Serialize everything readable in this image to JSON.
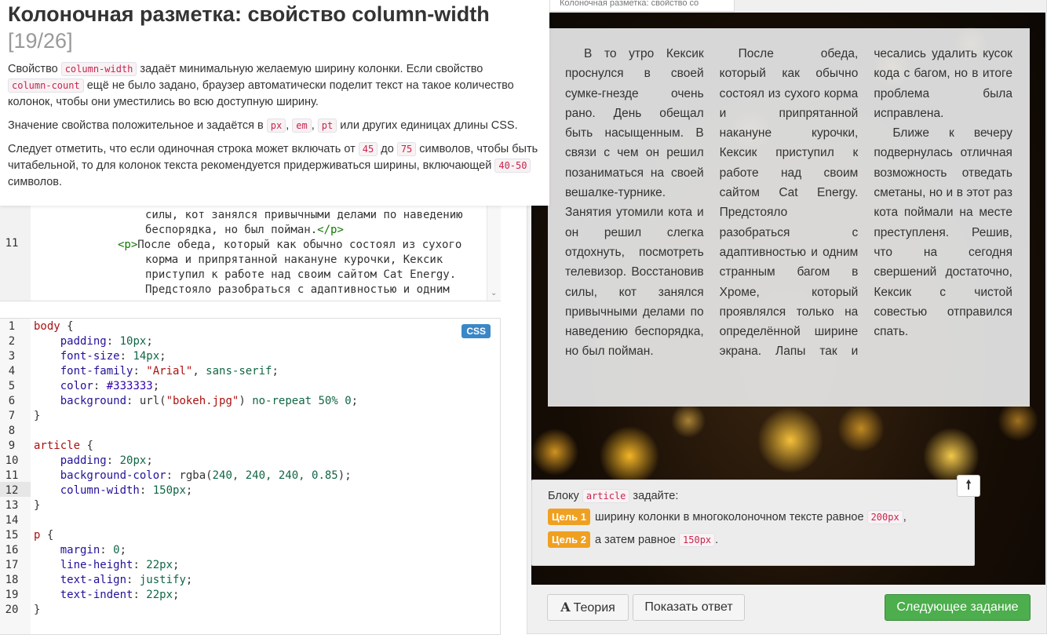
{
  "theory": {
    "title": "Колоночная разметка: свойство column-width",
    "counter": "[19/26]",
    "p1": {
      "t1": "Свойство ",
      "c1": "column-width",
      "t2": " задаёт минимальную желаемую ширину колонки. Если свойство ",
      "c2": "column-count",
      "t3": " ещё не было задано, браузер автоматически поделит текст на такое количество колонок, чтобы они уместились во всю доступную ширину."
    },
    "p2": {
      "t1": "Значение свойства положительное и задаётся в ",
      "c1": "px",
      "s1": ", ",
      "c2": "em",
      "s2": ", ",
      "c3": "pt",
      "t2": " или других единицах длины CSS."
    },
    "p3": {
      "t1": "Следует отметить, что если одиночная строка может включать от ",
      "c1": "45",
      "t2": " до ",
      "c2": "75",
      "t3": " символов, чтобы быть читабельной, то для колонок текста рекомендуется придерживаться ширины, включающей ",
      "c3": "40-50",
      "t4": " символов."
    }
  },
  "html_editor": {
    "line_number": "11",
    "line_a": "силы, кот занялся привычными делами по наведению",
    "line_b_text": "беспорядка, но был пойман.",
    "line_b_tag": "</p>",
    "line_c_tag": "<p>",
    "line_c_text": "После обеда, который как обычно состоял из сухого",
    "line_d": "корма и припрятанной накануне курочки, Кексик",
    "line_e": "приступил к работе над своим сайтом Cat Energy.",
    "line_f": "Предстояло разобраться с адаптивностью и одним"
  },
  "css_editor": {
    "badge": "CSS",
    "line_numbers": [
      "1",
      "2",
      "3",
      "4",
      "5",
      "6",
      "7",
      "8",
      "9",
      "10",
      "11",
      "12",
      "13",
      "14",
      "15",
      "16",
      "17",
      "18",
      "19",
      "20"
    ],
    "l1_sel": "body",
    "l1_brace": " {",
    "l2_prop": "padding",
    "l2_val": "10px",
    "l3_prop": "font-size",
    "l3_val": "14px",
    "l4_prop": "font-family",
    "l4_str": "\"Arial\"",
    "l4_kw": "sans-serif",
    "l5_prop": "color",
    "l5_val": "#333333",
    "l6_prop": "background",
    "l6_fn": "url(",
    "l6_str": "\"bokeh.jpg\"",
    "l6_fn_end": ")",
    "l6_kw": "no-repeat",
    "l6_num1": "50%",
    "l6_num2": "0",
    "l7": "}",
    "l9_sel": "article",
    "l9_brace": " {",
    "l10_prop": "padding",
    "l10_val": "20px",
    "l11_prop": "background-color",
    "l11_fn": "rgba(",
    "l11_nums": "240, 240, 240, 0.85",
    "l11_end": ")",
    "l12_prop": "column-width",
    "l12_val": "150px",
    "l13": "}",
    "l15_sel": "p",
    "l15_brace": " {",
    "l16_prop": "margin",
    "l16_val": "0",
    "l17_prop": "line-height",
    "l17_val": "22px",
    "l18_prop": "text-align",
    "l18_kw": "justify",
    "l19_prop": "text-indent",
    "l19_val": "22px",
    "l20": "}"
  },
  "preview": {
    "tab_title": "Колоночная разметка: свойство co",
    "article_p1": "В то утро Кексик проснулся в своей сумке-гнезде очень рано. День обещал быть насыщенным. В связи с чем он решил позаниматься на своей вешалке-турнике. Занятия утомили кота и он решил слегка отдохнуть, посмотреть телевизор. Восстановив силы, кот занялся привычными делами по наведению беспорядка, но был пойман.",
    "article_p2": "После обеда, который как обычно состоял из сухого корма и припрятанной накануне курочки, Кексик приступил к работе над своим сайтом Cat Energy. Предстояло разобраться с адаптивностью и одним странным багом в Хроме, который проявлялся только на определённой ширине экрана. Лапы так и чесались удалить кусок кода с багом, но в итоге проблема была исправлена.",
    "article_p3": "Ближе к вечеру подвернулась отличная возможность отведать сметаны, но и в этот раз кота поймали на месте преступленя. Решив, что на сегодня свершений достаточно, Кексик с чистой совестью отправился спать."
  },
  "task": {
    "intro_t1": "Блоку ",
    "intro_code": "article",
    "intro_t2": " задайте:",
    "goal1_badge": "Цель 1",
    "goal1_text": "ширину колонки в многоколоночном тексте равное ",
    "goal1_code": "200px",
    "goal1_end": ",",
    "goal2_badge": "Цель 2",
    "goal2_text": "а затем равное ",
    "goal2_code": "150px",
    "goal2_end": ".",
    "up_icon": "arrow-up-icon"
  },
  "buttons": {
    "theory_icon": "A",
    "theory": "Теория",
    "answer": "Показать ответ",
    "next": "Следующее задание"
  },
  "colors": {
    "accent_green": "#4cae4c",
    "goal_orange": "#f0a020",
    "css_badge_blue": "#3a87c7",
    "inline_code": "#c7254e"
  }
}
